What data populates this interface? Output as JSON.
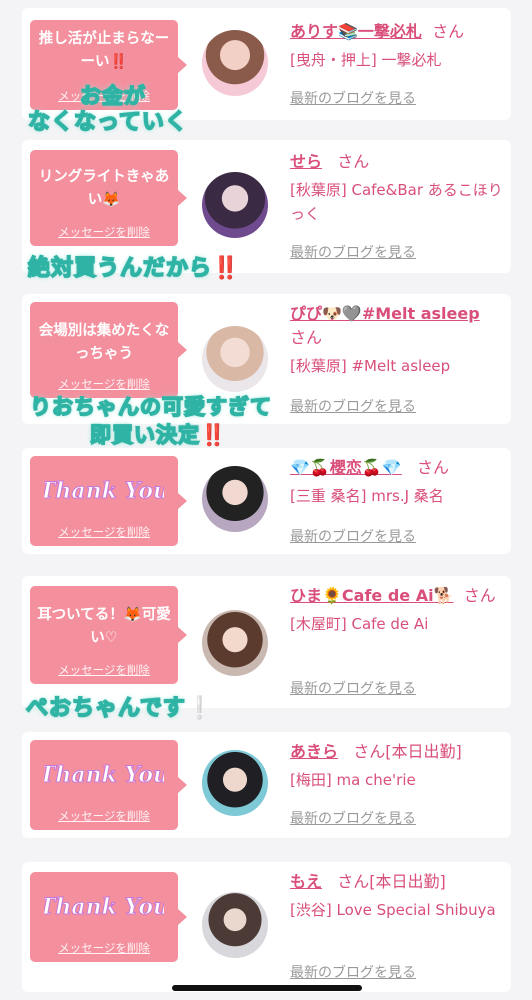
{
  "delete_label": "メッセージを削除",
  "blog_label": "最新のブログを見る",
  "honorific": "さん",
  "cards": [
    {
      "message": "推し活が止まらなーーい‼️",
      "name": "ありす📚一撃必札",
      "status": "",
      "shop": "[曳舟・押上] 一撃必札"
    },
    {
      "message": "リングライトきゃあい🦊",
      "name": "せら",
      "status": "",
      "shop": "[秋葉原] Cafe&Bar あるこほりっく"
    },
    {
      "message": "会場別は集めたくなっちゃう",
      "name": "ぴぴ🐶🩶#Melt asleep",
      "status": "",
      "shop": "[秋葉原] #Melt asleep"
    },
    {
      "message": "Thank You",
      "name": "💎🍒櫻恋🍒💎",
      "status": "",
      "shop": "[三重 桑名] mrs.J 桑名"
    },
    {
      "message": "耳ついてる！🦊可愛い♡",
      "name": "ひま🌻Cafe de Ai🐕",
      "status": "",
      "shop": "[木屋町] Cafe de Ai"
    },
    {
      "message": "Thank You",
      "name": "あきら",
      "status": "[本日出勤]",
      "shop": "[梅田] ma che'rie"
    },
    {
      "message": "Thank You",
      "name": "もえ",
      "status": "[本日出勤]",
      "shop": "[渋谷] Love Special Shibuya"
    }
  ],
  "overlays": [
    {
      "line1": "お金が",
      "line2": "なくなっていく"
    },
    {
      "text": "絶対買うんだから",
      "mark": "‼️"
    },
    {
      "line1": "りおちゃんの可愛すぎて",
      "line2": "即買い決定",
      "mark": "‼️"
    },
    {
      "text": "ぺおちゃんです",
      "mark": "❕"
    }
  ]
}
